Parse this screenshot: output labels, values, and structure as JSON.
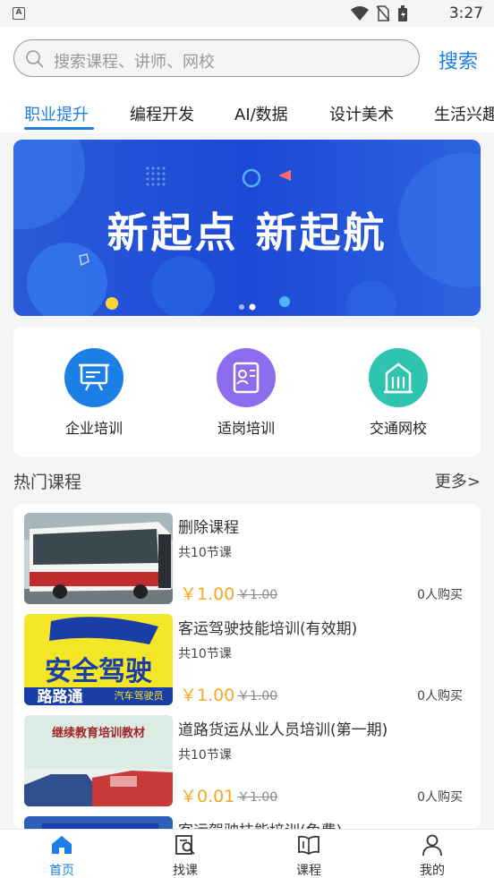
{
  "status_bar": {
    "app_indicator": "A",
    "time": "3:27"
  },
  "search": {
    "placeholder": "搜索课程、讲师、网校",
    "button_label": "搜索"
  },
  "tabs": [
    {
      "label": "职业提升",
      "active": true
    },
    {
      "label": "编程开发",
      "active": false
    },
    {
      "label": "AI/数据",
      "active": false
    },
    {
      "label": "设计美术",
      "active": false
    },
    {
      "label": "生活兴趣",
      "active": false
    }
  ],
  "banner": {
    "text": "新起点 新起航"
  },
  "quick_entries": [
    {
      "label": "企业培训",
      "icon": "presentation-board-icon",
      "color": "#1b7fe6"
    },
    {
      "label": "适岗培训",
      "icon": "resume-card-icon",
      "color": "#8e6cf0"
    },
    {
      "label": "交通网校",
      "icon": "building-icon",
      "color": "#2ec4b0"
    }
  ],
  "hot_courses": {
    "title": "热门课程",
    "more": "更多>",
    "items": [
      {
        "title": "删除课程",
        "lessons": "共10节课",
        "price": "￥1.00",
        "original_price": "￥1.00",
        "buyers": "0人购买"
      },
      {
        "title": "客运驾驶技能培训(有效期)",
        "lessons": "共10节课",
        "price": "￥1.00",
        "original_price": "￥1.00",
        "buyers": "0人购买",
        "thumb_text": "安全驾驶",
        "thumb_subtext": "路路通",
        "thumb_caption": "汽车驾驶员"
      },
      {
        "title": "道路货运从业人员培训(第一期)",
        "lessons": "共10节课",
        "price": "￥0.01",
        "original_price": "￥1.00",
        "buyers": "0人购买",
        "thumb_text": "继续教育培训教材"
      },
      {
        "title": "客运驾驶技能培训(免费)"
      }
    ]
  },
  "bottom_nav": [
    {
      "label": "首页",
      "icon": "home-icon",
      "active": true
    },
    {
      "label": "找课",
      "icon": "find-course-icon",
      "active": false
    },
    {
      "label": "课程",
      "icon": "book-icon",
      "active": false
    },
    {
      "label": "我的",
      "icon": "user-icon",
      "active": false
    }
  ]
}
